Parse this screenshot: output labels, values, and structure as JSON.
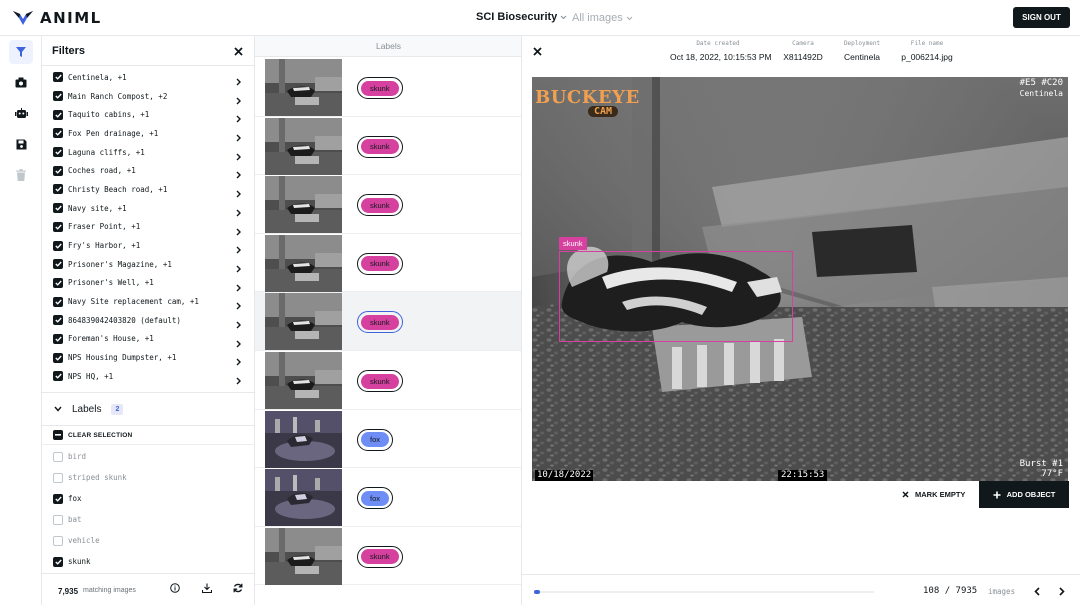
{
  "app": {
    "logo_text": "ANIML",
    "project": "SCI Biosecurity",
    "view": "All images",
    "sign_out": "SIGN OUT"
  },
  "filters": {
    "title": "Filters",
    "cameras": [
      {
        "label": "Centinela, +1",
        "checked": true
      },
      {
        "label": "Main Ranch Compost, +2",
        "checked": true
      },
      {
        "label": "Taquito cabins, +1",
        "checked": true
      },
      {
        "label": "Fox Pen drainage, +1",
        "checked": true
      },
      {
        "label": "Laguna cliffs, +1",
        "checked": true
      },
      {
        "label": "Coches road, +1",
        "checked": true
      },
      {
        "label": "Christy Beach road, +1",
        "checked": true
      },
      {
        "label": "Navy site, +1",
        "checked": true
      },
      {
        "label": "Fraser Point, +1",
        "checked": true
      },
      {
        "label": "Fry's Harbor, +1",
        "checked": true
      },
      {
        "label": "Prisoner's Magazine, +1",
        "checked": true
      },
      {
        "label": "Prisoner's Well, +1",
        "checked": true
      },
      {
        "label": "Navy Site replacement cam, +1",
        "checked": true
      },
      {
        "label": "864839042403820 (default)",
        "checked": true
      },
      {
        "label": "Foreman's House, +1",
        "checked": true
      },
      {
        "label": "NPS Housing Dumpster, +1",
        "checked": true
      },
      {
        "label": "NPS HQ, +1",
        "checked": true
      }
    ],
    "labels_section": {
      "title": "Labels",
      "count": "2",
      "clear": "CLEAR SELECTION"
    },
    "labels": [
      {
        "label": "bird",
        "checked": false
      },
      {
        "label": "striped skunk",
        "checked": false
      },
      {
        "label": "fox",
        "checked": true
      },
      {
        "label": "bat",
        "checked": false
      },
      {
        "label": "vehicle",
        "checked": false
      },
      {
        "label": "skunk",
        "checked": true
      }
    ],
    "footer": {
      "count": "7,935",
      "text": "matching images"
    }
  },
  "image_list": {
    "header": "Labels",
    "rows": [
      {
        "label": "skunk",
        "color": "#d6409f",
        "selected": false,
        "scene": "skunk"
      },
      {
        "label": "skunk",
        "color": "#d6409f",
        "selected": false,
        "scene": "skunk"
      },
      {
        "label": "skunk",
        "color": "#d6409f",
        "selected": false,
        "scene": "skunk"
      },
      {
        "label": "skunk",
        "color": "#d6409f",
        "selected": false,
        "scene": "skunk"
      },
      {
        "label": "skunk",
        "color": "#d6409f",
        "selected": true,
        "scene": "skunk"
      },
      {
        "label": "skunk",
        "color": "#d6409f",
        "selected": false,
        "scene": "skunk"
      },
      {
        "label": "fox",
        "color": "#6e8ef5",
        "selected": false,
        "scene": "fox"
      },
      {
        "label": "fox",
        "color": "#6e8ef5",
        "selected": false,
        "scene": "fox"
      },
      {
        "label": "skunk",
        "color": "#d6409f",
        "selected": false,
        "scene": "skunk"
      }
    ]
  },
  "detail": {
    "meta": [
      {
        "key": "Date created",
        "value": "Oct 18, 2022, 10:15:53 PM"
      },
      {
        "key": "Camera",
        "value": "X811492D"
      },
      {
        "key": "Deployment",
        "value": "Centinela"
      },
      {
        "key": "File name",
        "value": "p_006214.jpg"
      }
    ],
    "photo": {
      "brand_top": "BUCKEYE",
      "brand_bottom": "CAM",
      "stamp_top_right_1": "#E5 #C20",
      "stamp_top_right_2": "Centinela",
      "date": "10/18/2022",
      "time": "22:15:53",
      "burst": "Burst #1",
      "temp": "77°F",
      "object_label": "skunk"
    },
    "actions": {
      "mark_empty": "MARK EMPTY",
      "add_object": "ADD OBJECT"
    },
    "pager": {
      "current": "108",
      "sep": "/",
      "total": "7935",
      "unit": "images",
      "progress_fraction": 0.0136
    }
  },
  "colors": {
    "accent": "#3e63dd",
    "skunk": "#d6409f",
    "fox": "#6e8ef5",
    "dark": "#11181c"
  }
}
